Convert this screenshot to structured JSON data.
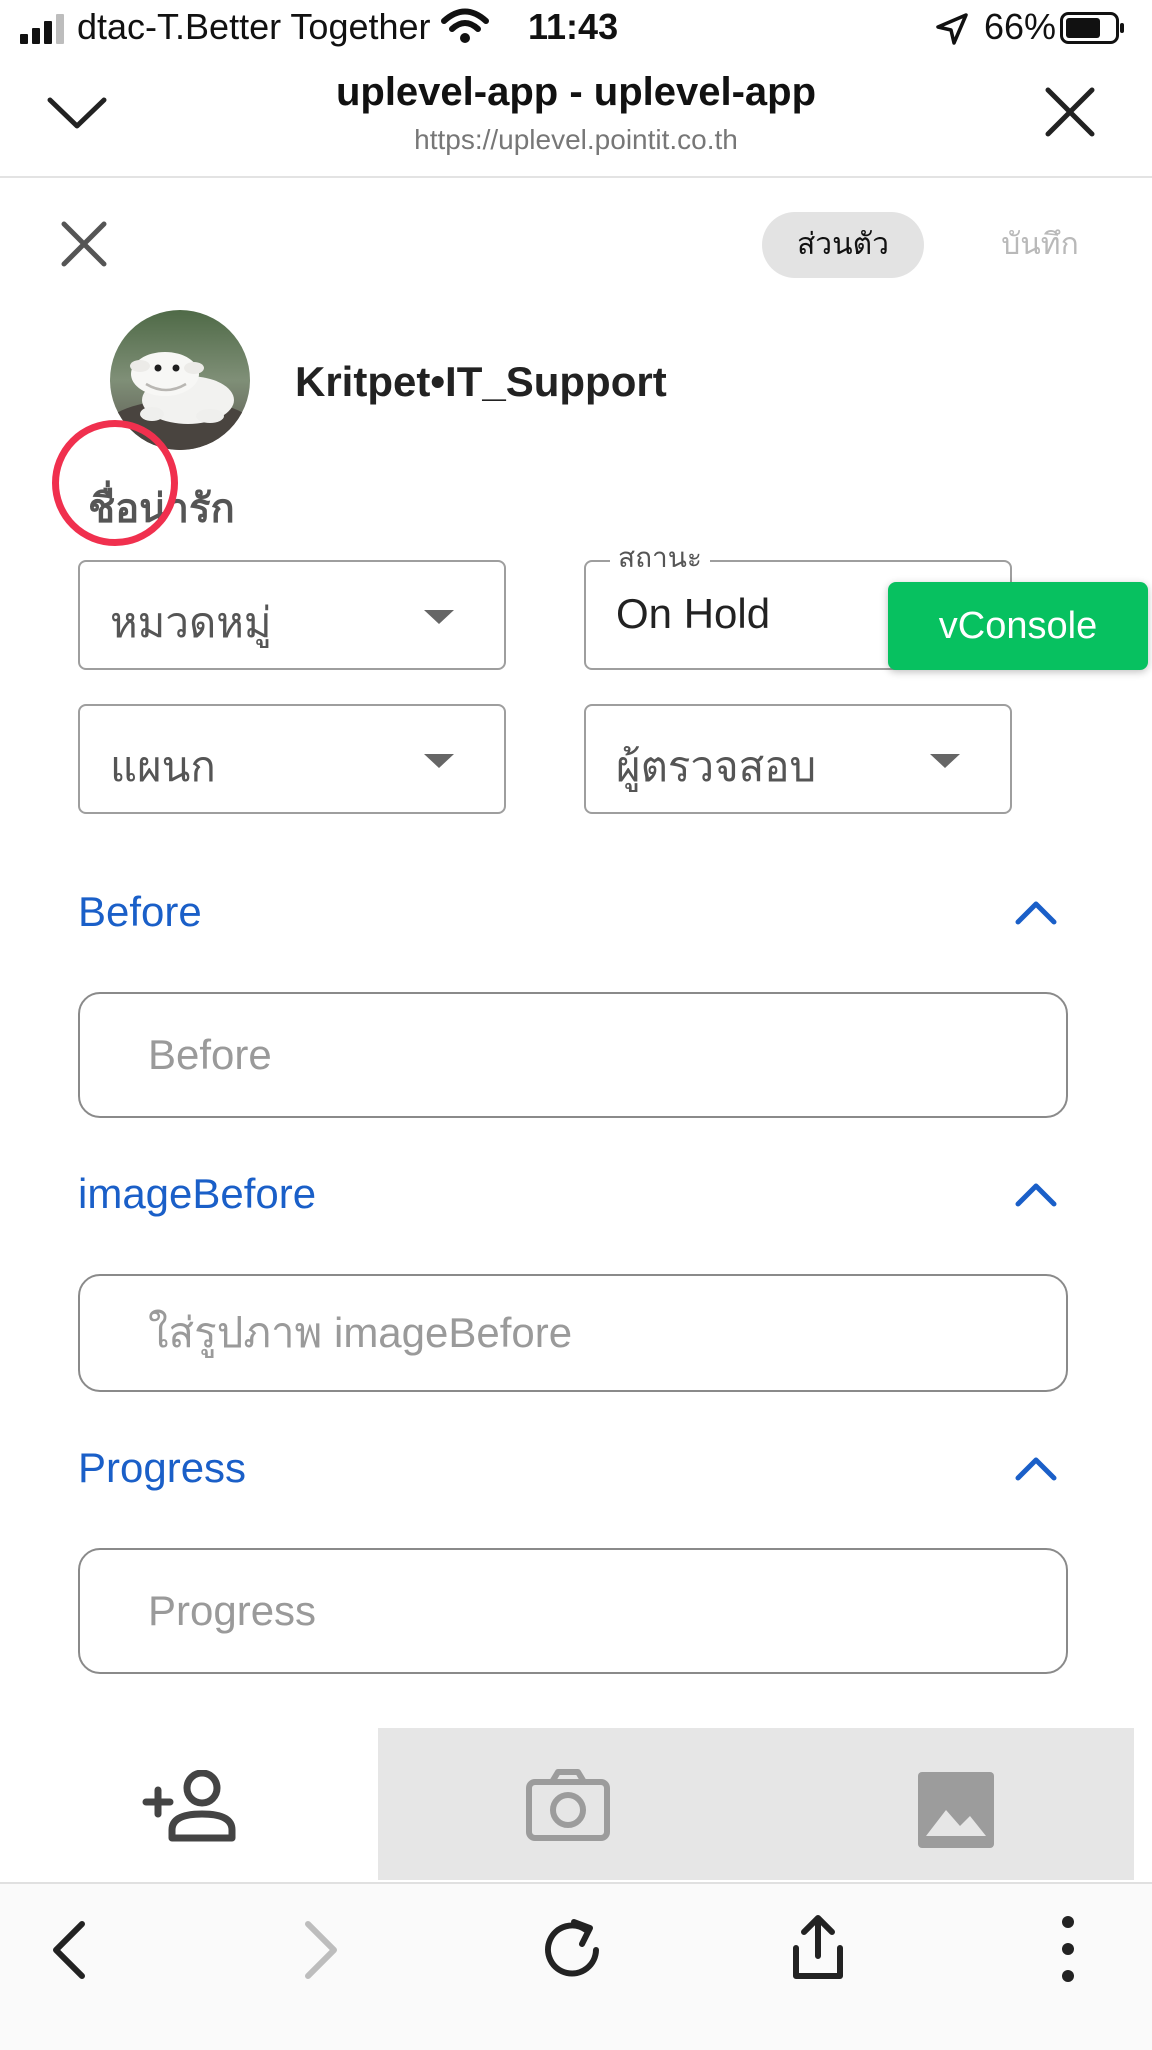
{
  "status_bar": {
    "carrier": "dtac-T.Better Together",
    "time": "11:43",
    "battery": "66%"
  },
  "browser": {
    "title": "uplevel-app - uplevel-app",
    "url": "https://uplevel.pointit.co.th"
  },
  "form": {
    "private_label": "ส่วนตัว",
    "save_label": "บันทึก",
    "username": "Kritpet•IT_Support",
    "nickname_label": "ชื่อน่ารัก",
    "category_placeholder": "หมวดหมู่",
    "status_label": "สถานะ",
    "status_value": "On Hold",
    "department_placeholder": "แผนก",
    "inspector_placeholder": "ผู้ตรวจสอบ",
    "vconsole_label": "vConsole"
  },
  "sections": [
    {
      "title": "Before",
      "placeholder": "Before"
    },
    {
      "title": "imageBefore",
      "placeholder": "ใส่รูปภาพ imageBefore"
    },
    {
      "title": "Progress",
      "placeholder": "Progress"
    }
  ],
  "bottom_tabs": {
    "icons": [
      "add-person-icon",
      "camera-icon",
      "image-icon"
    ]
  },
  "colors": {
    "accent_blue": "#1a5fc8",
    "vconsole_green": "#07c160",
    "highlight_ring": "#f0304e"
  }
}
